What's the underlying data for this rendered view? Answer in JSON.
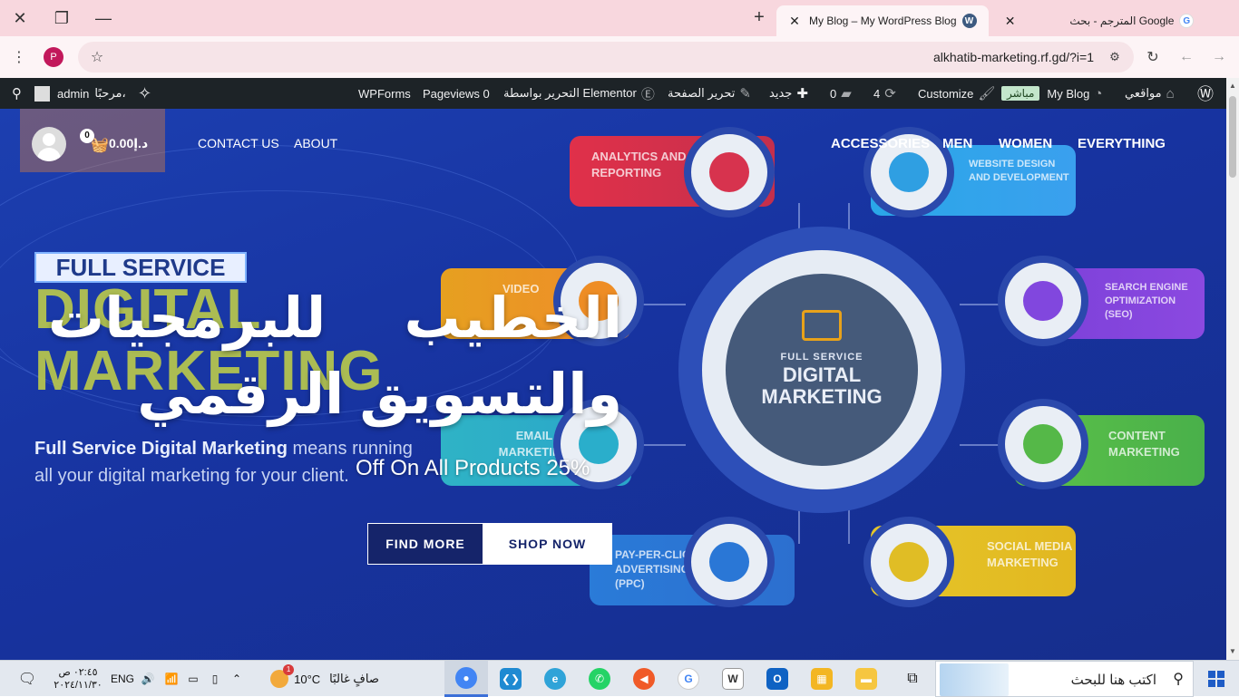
{
  "browser": {
    "tabs": [
      {
        "title": "My Blog – My WordPress Blog",
        "active": true
      },
      {
        "title": "المترجم - بحث Google",
        "active": false
      }
    ],
    "url": "alkhatib-marketing.rf.gd/?i=1",
    "profile_initial": "P"
  },
  "admin_bar": {
    "my_sites": "مواقعي",
    "site_name": "My Blog",
    "live_badge": "مباشر",
    "customize": "Customize",
    "updates_count": "4",
    "comments_count": "0",
    "new": "جديد",
    "edit_page": "تحرير الصفحة",
    "edit_with_elementor": "التحرير بواسطة Elementor",
    "pageviews": "Pageviews 0",
    "wpforms": "WPForms",
    "greeting": "مرحبًا،",
    "user": "admin"
  },
  "site_header": {
    "cart_count": "0",
    "cart_total": "د.إ0.00",
    "nav_left": [
      "CONTACT US",
      "ABOUT"
    ],
    "nav_right": [
      "ACCESSORIES",
      "MEN",
      "WOMEN",
      "EVERYTHING"
    ]
  },
  "hero": {
    "title_line1": "الخطيب     للبرمجيات",
    "title_line2": "والتسويق الرقمي",
    "subtitle": "Off On All Products 25%",
    "find_more": "FIND MORE",
    "shop_now": "SHOP NOW",
    "bg_badge": "FULL SERVICE",
    "bg_big1": "DIGITAL",
    "bg_big2": "MARKETING",
    "bg_desc_bold": "Full Service Digital Marketing",
    "bg_desc_rest": " means running all your digital marketing for your client.",
    "center_small": "FULL SERVICE",
    "center_big": "DIGITAL MARKETING",
    "pills": [
      {
        "label": "ANALYTICS AND REPORTING"
      },
      {
        "label": "WEBSITE DESIGN AND DEVELOPMENT"
      },
      {
        "label": "VIDEO"
      },
      {
        "label": "SEARCH ENGINE OPTIMIZATION (SEO)"
      },
      {
        "label": "EMAIL MARKETING"
      },
      {
        "label": "CONTENT MARKETING"
      },
      {
        "label": "PAY-PER-CLICK ADVERTISING (PPC)"
      },
      {
        "label": "SOCIAL MEDIA MARKETING"
      }
    ]
  },
  "taskbar": {
    "search_placeholder": "اكتب هنا للبحث",
    "weather_temp": "10°C",
    "weather_text": "صافٍ غالبًا",
    "lang": "ENG",
    "time": "٠٢:٤٥ ص",
    "date": "٢٠٢٤/١١/٣٠",
    "weather_badge": "1"
  }
}
